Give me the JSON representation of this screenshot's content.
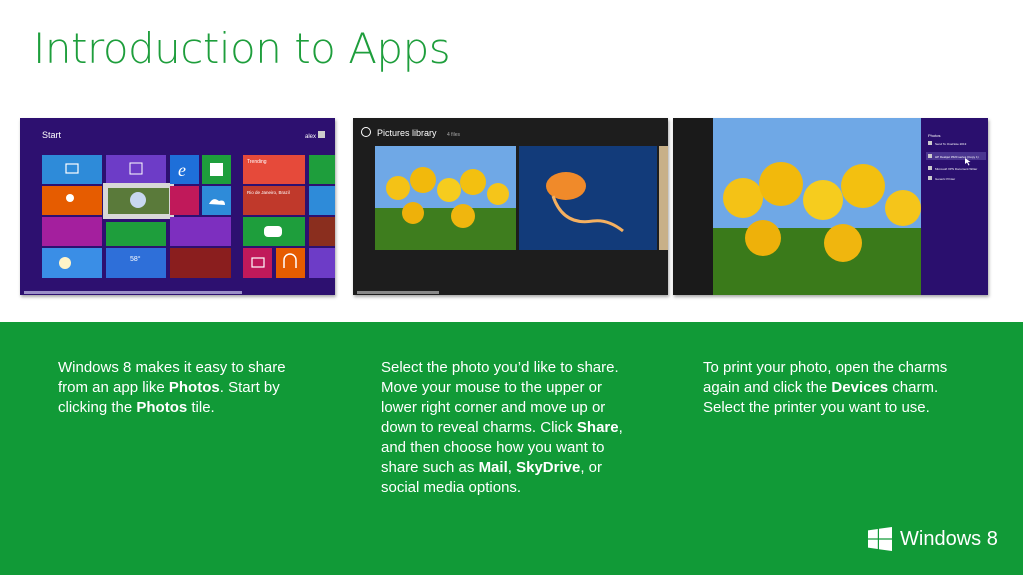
{
  "slide": {
    "title": "Introduction to Apps"
  },
  "screenshots": {
    "start": {
      "label": "Start",
      "user": "alex",
      "tile_news_line1": "Trending",
      "tile_news_line2": "Rio de Janeiro, Brazil",
      "tile_weather": "58°"
    },
    "pictures": {
      "label": "Pictures library",
      "count": "4 files"
    },
    "charms": {
      "label": "Photos",
      "items": [
        "Send To OneNote 2013",
        "HP Deskjet 3520 series (Copy 1)",
        "Microsoft XPS Document Writer",
        "Generic Printer"
      ]
    }
  },
  "descriptions": {
    "col1": {
      "t1": "Windows 8 makes it easy to share from an app like ",
      "b1": "Photos",
      "t2": ".  Start by clicking the ",
      "b2": "Photos",
      "t3": " tile."
    },
    "col2": {
      "t1": "Select the photo you’d like to share.  Move your mouse to the upper or lower right corner and move up or down to reveal charms. Click ",
      "b1": "Share",
      "t2": ", and then choose how you want to share such as ",
      "b2": "Mail",
      "t3": ", ",
      "b3": "SkyDrive",
      "t4": ", or social media options."
    },
    "col3": {
      "t1": "To print your photo, open the charms again and click the ",
      "b1": "Devices",
      "t2": " charm.  Select the printer you want to use."
    }
  },
  "branding": {
    "product": "Windows 8"
  },
  "colors": {
    "accent_green": "#119a37",
    "title_green": "#1e9e3c",
    "start_bg": "#2a0f6e"
  }
}
